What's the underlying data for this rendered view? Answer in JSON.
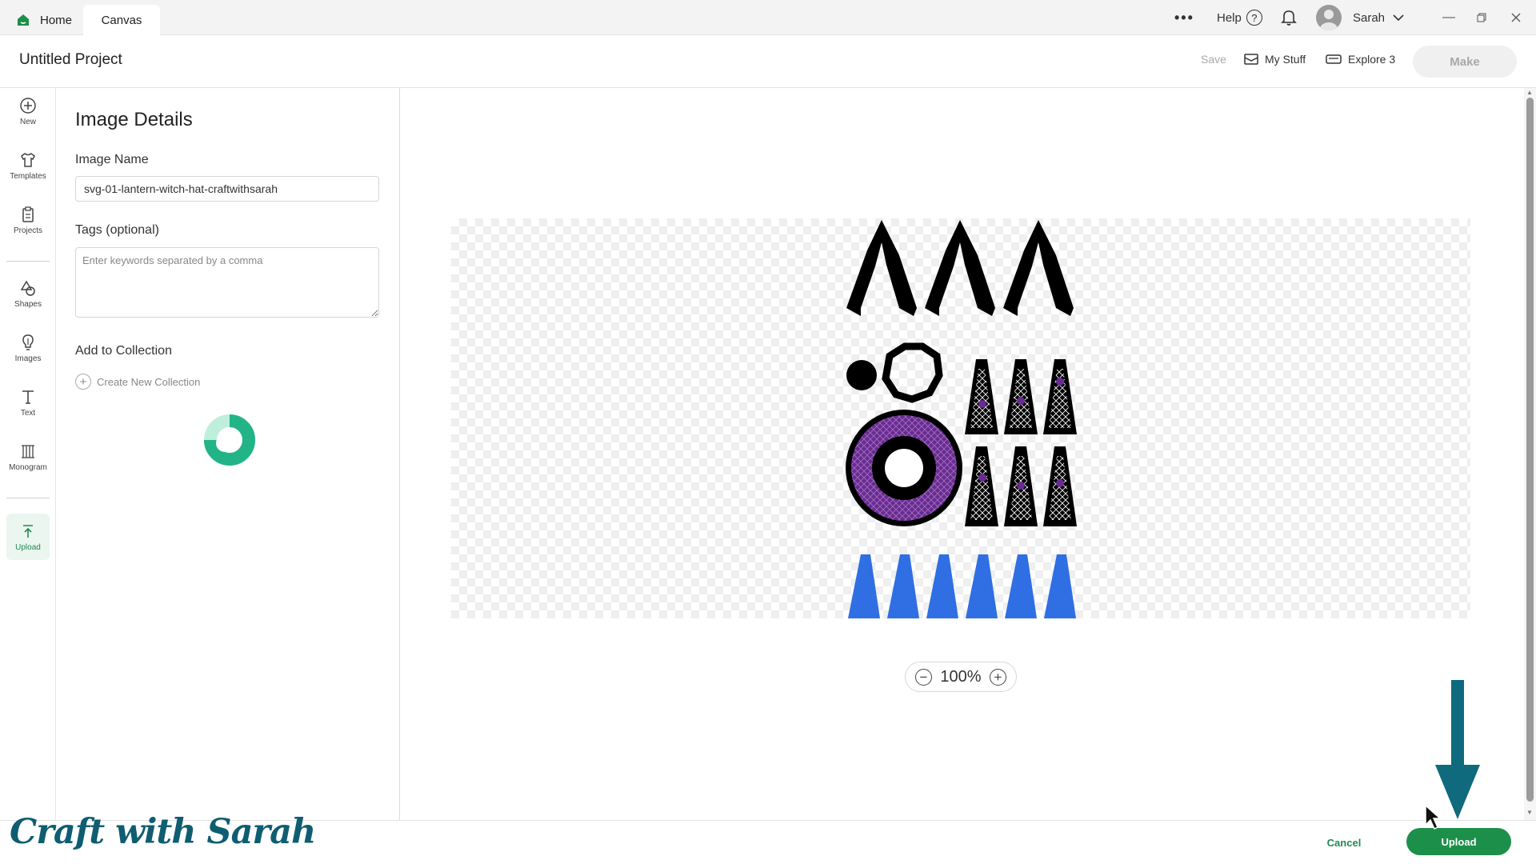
{
  "tabs": {
    "home": "Home",
    "canvas": "Canvas"
  },
  "titlebar": {
    "more": "•••",
    "help": "Help",
    "help_glyph": "?",
    "user": "Sarah"
  },
  "project": {
    "title": "Untitled Project",
    "save": "Save",
    "my_stuff": "My Stuff",
    "machine": "Explore 3",
    "make": "Make"
  },
  "tools": [
    {
      "label": "New",
      "icon": "plus-circle-icon"
    },
    {
      "label": "Templates",
      "icon": "shirt-icon"
    },
    {
      "label": "Projects",
      "icon": "clipboard-icon"
    },
    {
      "label": "Shapes",
      "icon": "shapes-icon"
    },
    {
      "label": "Images",
      "icon": "lightbulb-icon"
    },
    {
      "label": "Text",
      "icon": "text-icon"
    },
    {
      "label": "Monogram",
      "icon": "monogram-icon"
    },
    {
      "label": "Upload",
      "icon": "upload-icon"
    }
  ],
  "panel": {
    "title": "Image Details",
    "name_label": "Image Name",
    "name_value": "svg-01-lantern-witch-hat-craftwithsarah",
    "tags_label": "Tags (optional)",
    "tags_placeholder": "Enter keywords separated by a comma",
    "collection_label": "Add to Collection",
    "new_collection": "Create New Collection"
  },
  "zoom": {
    "level": "100%",
    "minus": "−",
    "plus": "+"
  },
  "footer": {
    "cancel": "Cancel",
    "upload": "Upload",
    "logo": "Craft with Sarah"
  },
  "colors": {
    "accent": "#1c8f4a",
    "annotation": "#0f6a7e",
    "purple": "#6a2a93",
    "blue": "#2f6fe3"
  }
}
